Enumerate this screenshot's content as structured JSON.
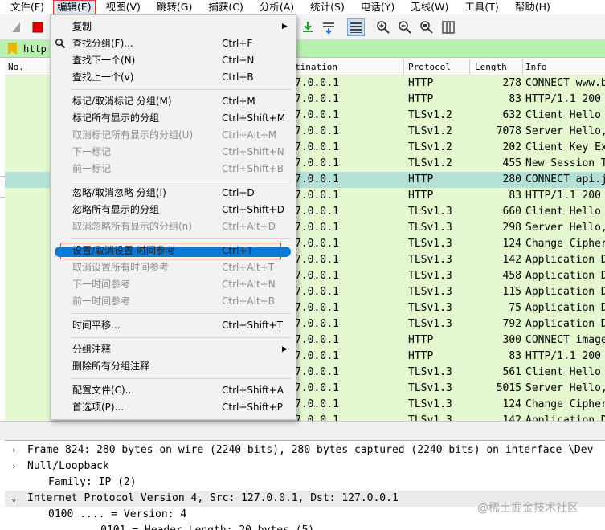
{
  "menubar": [
    {
      "name": "menu-file",
      "label": "文件(F)"
    },
    {
      "name": "menu-edit",
      "label": "编辑(E)"
    },
    {
      "name": "menu-view",
      "label": "视图(V)"
    },
    {
      "name": "menu-go",
      "label": "跳转(G)"
    },
    {
      "name": "menu-capture",
      "label": "捕获(C)"
    },
    {
      "name": "menu-analyze",
      "label": "分析(A)"
    },
    {
      "name": "menu-statistics",
      "label": "统计(S)"
    },
    {
      "name": "menu-telephony",
      "label": "电话(Y)"
    },
    {
      "name": "menu-wireless",
      "label": "无线(W)"
    },
    {
      "name": "menu-tools",
      "label": "工具(T)"
    },
    {
      "name": "menu-help",
      "label": "帮助(H)"
    }
  ],
  "filter": {
    "value": "http"
  },
  "packet_list": {
    "headers": {
      "no": "No.",
      "destination": "tination",
      "protocol": "Protocol",
      "length": "Length",
      "info": "Info"
    },
    "rows": [
      {
        "dst": "7.0.0.1",
        "proto": "HTTP",
        "len": "278",
        "info": "CONNECT www.b"
      },
      {
        "dst": "7.0.0.1",
        "proto": "HTTP",
        "len": "83",
        "info": "HTTP/1.1 200"
      },
      {
        "dst": "7.0.0.1",
        "proto": "TLSv1.2",
        "len": "632",
        "info": "Client Hello"
      },
      {
        "dst": "7.0.0.1",
        "proto": "TLSv1.2",
        "len": "7078",
        "info": "Server Hello,"
      },
      {
        "dst": "7.0.0.1",
        "proto": "TLSv1.2",
        "len": "202",
        "info": "Client Key Ex"
      },
      {
        "dst": "7.0.0.1",
        "proto": "TLSv1.2",
        "len": "455",
        "info": "New Session T"
      },
      {
        "dst": "7.0.0.1",
        "proto": "HTTP",
        "len": "280",
        "info": "CONNECT api.j"
      },
      {
        "dst": "7.0.0.1",
        "proto": "HTTP",
        "len": "83",
        "info": "HTTP/1.1 200"
      },
      {
        "dst": "7.0.0.1",
        "proto": "TLSv1.3",
        "len": "660",
        "info": "Client Hello"
      },
      {
        "dst": "7.0.0.1",
        "proto": "TLSv1.3",
        "len": "298",
        "info": "Server Hello,"
      },
      {
        "dst": "7.0.0.1",
        "proto": "TLSv1.3",
        "len": "124",
        "info": "Change Cipher"
      },
      {
        "dst": "7.0.0.1",
        "proto": "TLSv1.3",
        "len": "142",
        "info": "Application D"
      },
      {
        "dst": "7.0.0.1",
        "proto": "TLSv1.3",
        "len": "458",
        "info": "Application D"
      },
      {
        "dst": "7.0.0.1",
        "proto": "TLSv1.3",
        "len": "115",
        "info": "Application D"
      },
      {
        "dst": "7.0.0.1",
        "proto": "TLSv1.3",
        "len": "75",
        "info": "Application D"
      },
      {
        "dst": "7.0.0.1",
        "proto": "TLSv1.3",
        "len": "792",
        "info": "Application D"
      },
      {
        "dst": "7.0.0.1",
        "proto": "HTTP",
        "len": "300",
        "info": "CONNECT image"
      },
      {
        "dst": "7.0.0.1",
        "proto": "HTTP",
        "len": "83",
        "info": "HTTP/1.1 200"
      },
      {
        "dst": "7.0.0.1",
        "proto": "TLSv1.3",
        "len": "561",
        "info": "Client Hello"
      },
      {
        "dst": "7.0.0.1",
        "proto": "TLSv1.3",
        "len": "5015",
        "info": "Server Hello,"
      },
      {
        "dst": "7.0.0.1",
        "proto": "TLSv1.3",
        "len": "124",
        "info": "Change Cipher"
      },
      {
        "dst": "7.0.0.1",
        "proto": "TLSv1.3",
        "len": "142",
        "info": "Application D"
      }
    ],
    "selected_row": 6
  },
  "edit_menu": {
    "items": [
      {
        "label": "复制",
        "shortcut": "",
        "disabled": false,
        "submenu": true
      },
      {
        "label": "查找分组(F)...",
        "shortcut": "Ctrl+F",
        "disabled": false,
        "icon": "search-icon"
      },
      {
        "label": "查找下一个(N)",
        "shortcut": "Ctrl+N",
        "disabled": false
      },
      {
        "label": "查找上一个(v)",
        "shortcut": "Ctrl+B",
        "disabled": false
      },
      {
        "label": "标记/取消标记 分组(M)",
        "shortcut": "Ctrl+M",
        "disabled": false
      },
      {
        "label": "标记所有显示的分组",
        "shortcut": "Ctrl+Shift+M",
        "disabled": false
      },
      {
        "label": "取消标记所有显示的分组(U)",
        "shortcut": "Ctrl+Alt+M",
        "disabled": true
      },
      {
        "label": "下一标记",
        "shortcut": "Ctrl+Shift+N",
        "disabled": true
      },
      {
        "label": "前一标记",
        "shortcut": "Ctrl+Shift+B",
        "disabled": true
      },
      {
        "label": "忽略/取消忽略 分组(I)",
        "shortcut": "Ctrl+D",
        "disabled": false
      },
      {
        "label": "忽略所有显示的分组",
        "shortcut": "Ctrl+Shift+D",
        "disabled": false
      },
      {
        "label": "取消忽略所有显示的分组(n)",
        "shortcut": "Ctrl+Alt+D",
        "disabled": true
      },
      {
        "label": "设置/取消设置 时间参考",
        "shortcut": "Ctrl+T",
        "disabled": false,
        "highlighted": true
      },
      {
        "label": "取消设置所有时间参考",
        "shortcut": "Ctrl+Alt+T",
        "disabled": true
      },
      {
        "label": "下一时间参考",
        "shortcut": "Ctrl+Alt+N",
        "disabled": true
      },
      {
        "label": "前一时间参考",
        "shortcut": "Ctrl+Alt+B",
        "disabled": true
      },
      {
        "label": "时间平移...",
        "shortcut": "Ctrl+Shift+T",
        "disabled": false
      },
      {
        "label": "分组注释",
        "shortcut": "",
        "disabled": false,
        "submenu": true
      },
      {
        "label": "删除所有分组注释",
        "shortcut": "",
        "disabled": false
      },
      {
        "label": "配置文件(C)...",
        "shortcut": "Ctrl+Shift+A",
        "disabled": false
      },
      {
        "label": "首选项(P)...",
        "shortcut": "Ctrl+Shift+P",
        "disabled": false
      }
    ]
  },
  "detail": {
    "rows": [
      {
        "caret": "›",
        "text": "Frame 824: 280 bytes on wire (2240 bits), 280 bytes captured (2240 bits) on interface \\Dev",
        "indent": 0
      },
      {
        "caret": "›",
        "text": "Null/Loopback",
        "indent": 0
      },
      {
        "caret": "",
        "text": "Family: IP (2)",
        "indent": 1
      },
      {
        "caret": "⌄",
        "text": "Internet Protocol Version 4, Src: 127.0.0.1, Dst: 127.0.0.1",
        "indent": 0
      },
      {
        "caret": "",
        "text": "0100 .... = Version: 4",
        "indent": 1
      },
      {
        "caret": "",
        "text": ".... 0101 = Header Length: 20 bytes (5)",
        "indent": 2
      }
    ]
  },
  "watermark": "@稀土掘金技术社区",
  "colors": {
    "tls_row": "#e4f9cf",
    "selected_row": "#b4e1d6",
    "highlight": "#0a7ad6",
    "filter_bg": "#b8f0b0"
  }
}
